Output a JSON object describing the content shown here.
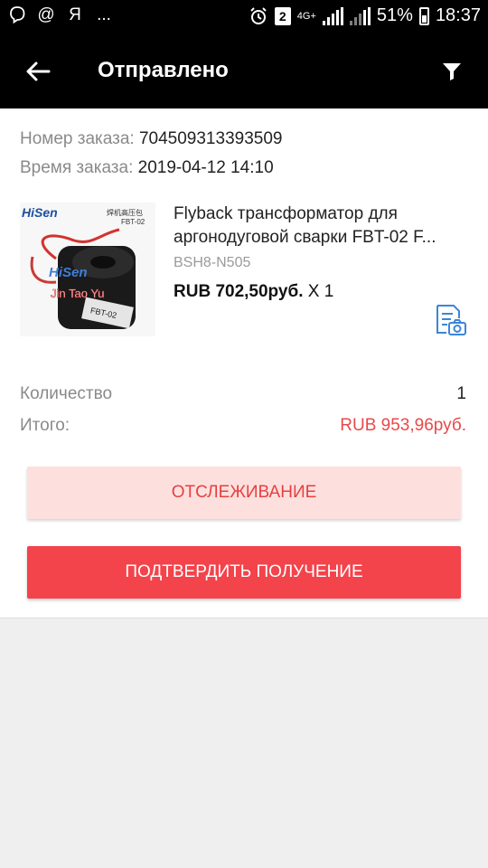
{
  "status_bar": {
    "left_letter": "Я",
    "more": "...",
    "notif_count": "2",
    "network": "4G+",
    "battery": "51%",
    "time": "18:37"
  },
  "header": {
    "title": "Отправлено"
  },
  "order": {
    "number_label": "Номер заказа: ",
    "number": "704509313393509",
    "time_label": "Время заказа: ",
    "time": "2019-04-12 14:10"
  },
  "product": {
    "image_text": {
      "brand": "HiSen",
      "cn_top": "焊机高压包",
      "model": "FBT-02",
      "watermark": "Jin Tao Yu",
      "part_label": "FBT-02"
    },
    "title": "Flyback трансформатор для аргонодуговой сварки FBT-02 F...",
    "sku": "BSH8-N505",
    "price": "RUB 702,50руб.",
    "quantity": "X 1"
  },
  "summary": {
    "qty_label": "Количество",
    "qty_value": "1",
    "total_label": "Итого:",
    "total_value": "RUB 953,96руб."
  },
  "actions": {
    "track_label": "ОТСЛЕЖИВАНИЕ",
    "confirm_label": "ПОДТВЕРДИТЬ ПОЛУЧЕНИЕ"
  },
  "colors": {
    "accent": "#f3434b",
    "accent_light": "#fde0de",
    "price_red": "#e8484a",
    "icon_blue": "#3b86d6"
  }
}
